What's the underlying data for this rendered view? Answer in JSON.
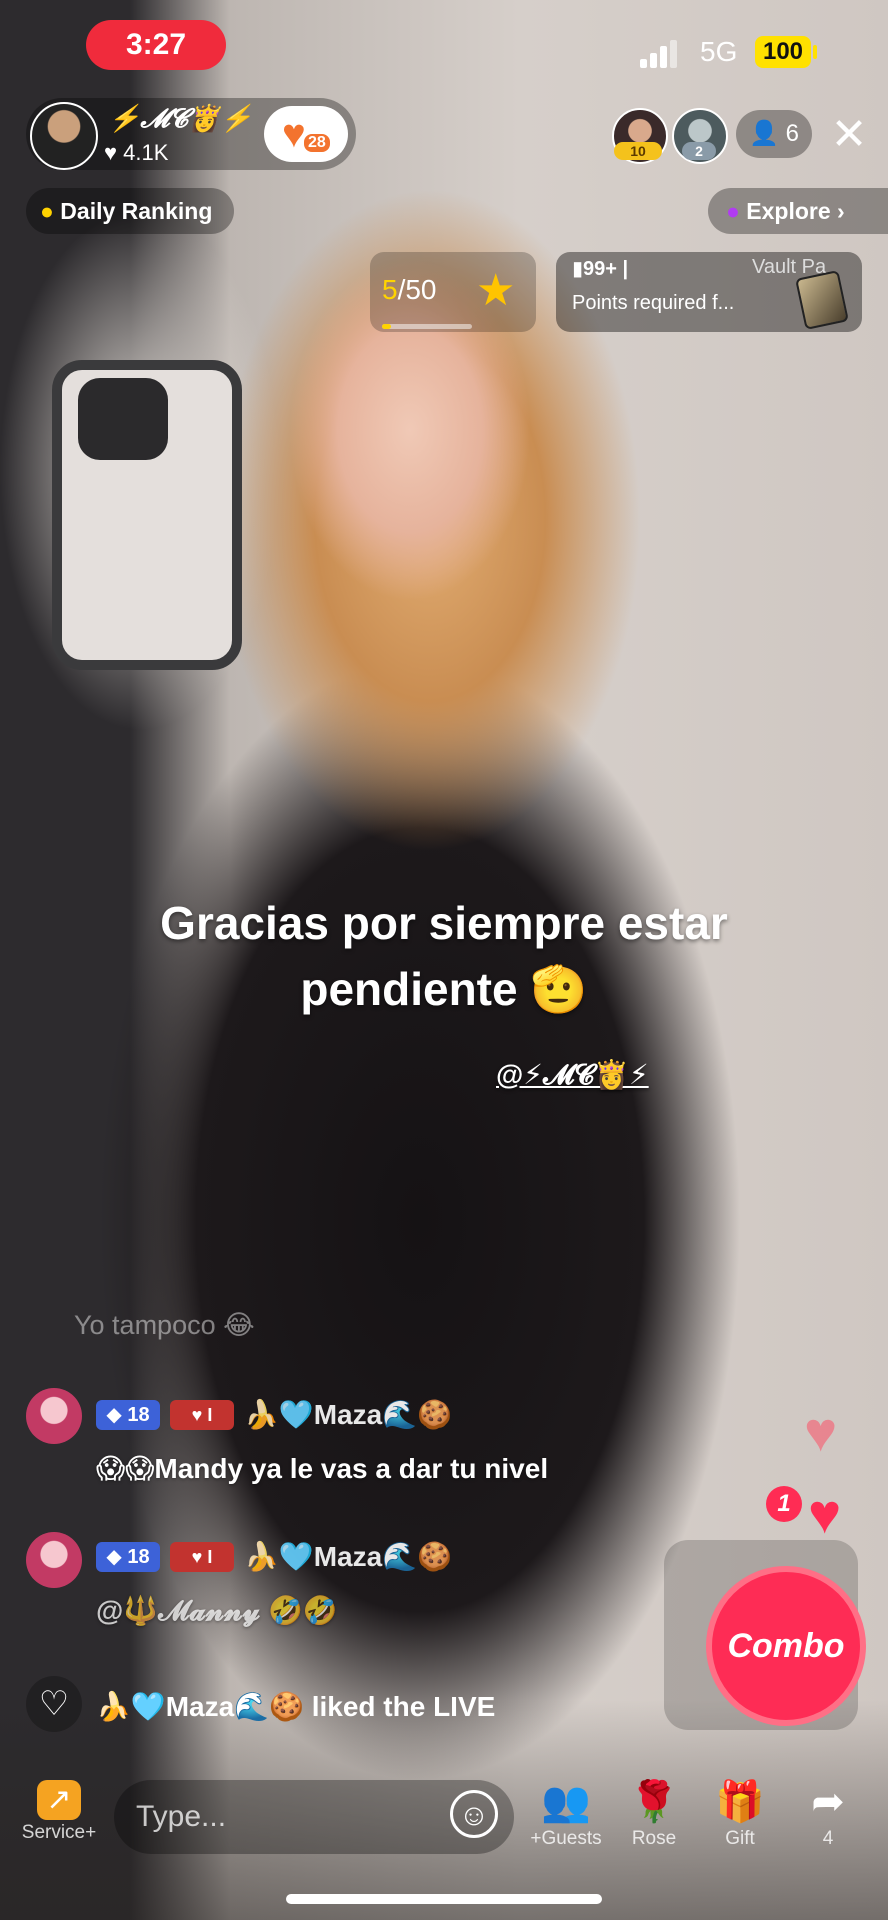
{
  "status_bar": {
    "time": "3:27",
    "network": "5G",
    "battery": "100"
  },
  "host": {
    "name": "⚡𝓜𝓒👸⚡",
    "likes": "♥ 4.1K",
    "follow_heart": "♥",
    "follow_count": "28"
  },
  "viewers": {
    "badges": [
      "10",
      "2"
    ],
    "count": "6",
    "close_label": "✕"
  },
  "daily_ranking": {
    "label": "Daily Ranking"
  },
  "explore": {
    "label": "Explore ›"
  },
  "goal": {
    "current": "5",
    "total": "/50",
    "progress_fraction": 0.1
  },
  "vault": {
    "rank": "99+ |",
    "title": "Vault Pa",
    "description": "Points required f..."
  },
  "caption": {
    "line1": "Gracias por siempre estar",
    "line2": "pendiente 🫡",
    "mention": "@⚡𝓜𝓒👸⚡"
  },
  "chat": {
    "faded_message": "Yo tampoco 😂",
    "messages": [
      {
        "level": "18",
        "fan_level": "I",
        "username": "🍌🩵Maza🌊🍪",
        "text": "😱😱Mandy ya le vas a dar tu nivel"
      },
      {
        "level": "18",
        "fan_level": "I",
        "username": "🍌🩵Maza🌊🍪",
        "text": "@🔱𝓜𝓪𝓷𝓷𝔂 🤣🤣"
      }
    ],
    "liked_event": "🍌🩵Maza🌊🍪 liked the LIVE"
  },
  "reactions": {
    "heart_count": "1",
    "combo_label": "Combo"
  },
  "bottom_bar": {
    "service_label": "Service+",
    "type_placeholder": "Type...",
    "guests_label": "+Guests",
    "rose_label": "Rose",
    "gift_label": "Gift",
    "share_count": "4"
  },
  "colors": {
    "accent_red": "#fe2c55",
    "time_pill": "#f02b3c",
    "battery": "#ffe100",
    "level_badge": "#3d62d8"
  }
}
